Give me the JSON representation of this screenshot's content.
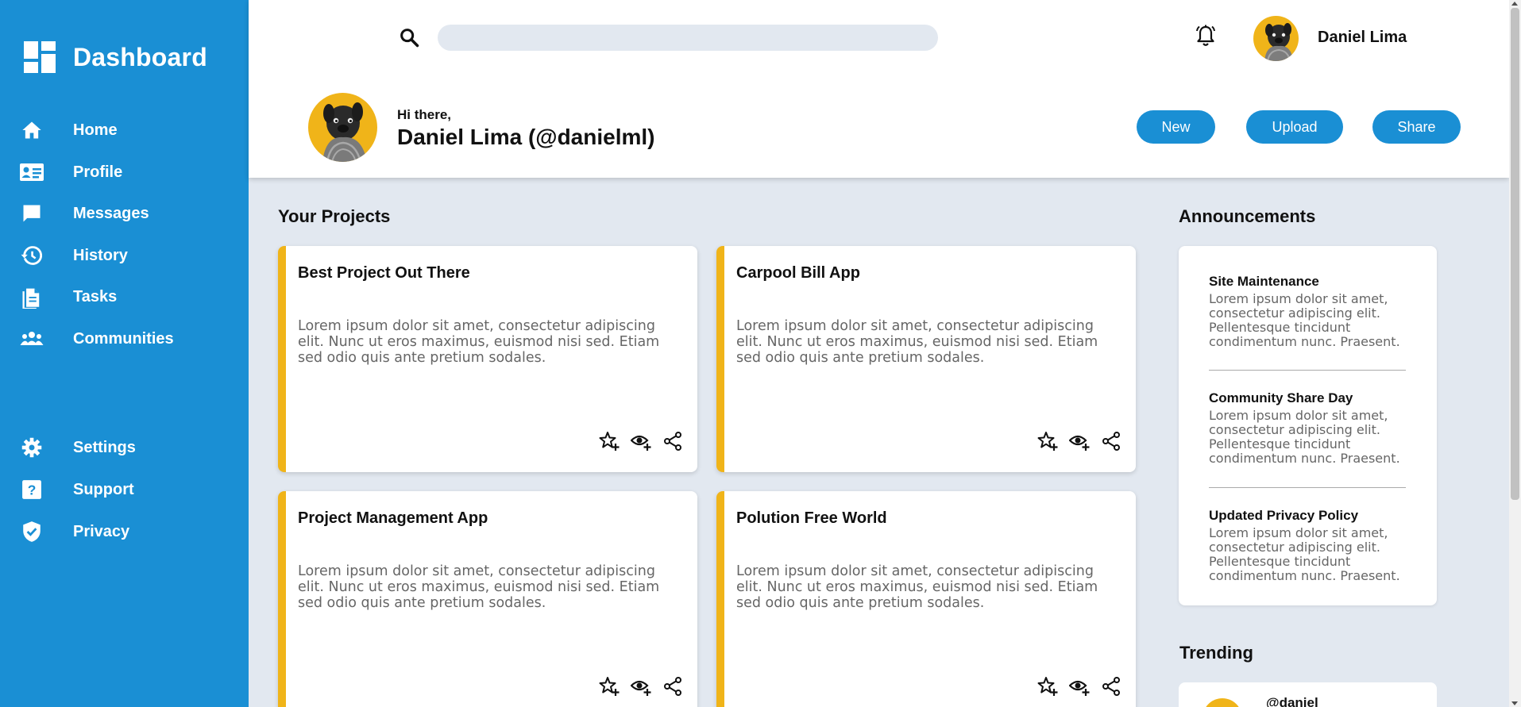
{
  "sidebar": {
    "title": "Dashboard",
    "items": [
      {
        "label": "Home",
        "icon": "home-icon"
      },
      {
        "label": "Profile",
        "icon": "id-card-icon"
      },
      {
        "label": "Messages",
        "icon": "chat-icon"
      },
      {
        "label": "History",
        "icon": "history-icon"
      },
      {
        "label": "Tasks",
        "icon": "document-icon"
      },
      {
        "label": "Communities",
        "icon": "people-icon"
      }
    ],
    "bottom_items": [
      {
        "label": "Settings",
        "icon": "gear-icon"
      },
      {
        "label": "Support",
        "icon": "help-icon"
      },
      {
        "label": "Privacy",
        "icon": "shield-icon"
      }
    ]
  },
  "header": {
    "search": {
      "placeholder": ""
    },
    "user_name": "Daniel Lima",
    "greeting": "Hi there,",
    "full_name": "Daniel Lima (@danielml)",
    "buttons": {
      "new": "New",
      "upload": "Upload",
      "share": "Share"
    }
  },
  "projects": {
    "title": "Your Projects",
    "cards": [
      {
        "title": "Best Project Out There",
        "description": "Lorem ipsum dolor sit amet, consectetur adipiscing elit. Nunc ut eros maximus, euismod nisi sed. Etiam sed odio quis ante pretium sodales."
      },
      {
        "title": "Carpool Bill App",
        "description": "Lorem ipsum dolor sit amet, consectetur adipiscing elit. Nunc ut eros maximus, euismod nisi sed. Etiam sed odio quis ante pretium sodales."
      },
      {
        "title": "Project Management App",
        "description": "Lorem ipsum dolor sit amet, consectetur adipiscing elit. Nunc ut eros maximus, euismod nisi sed. Etiam sed odio quis ante pretium sodales."
      },
      {
        "title": "Polution Free World",
        "description": "Lorem ipsum dolor sit amet, consectetur adipiscing elit. Nunc ut eros maximus, euismod nisi sed. Etiam sed odio quis ante pretium sodales."
      }
    ]
  },
  "announcements": {
    "title": "Announcements",
    "items": [
      {
        "title": "Site Maintenance",
        "body": "Lorem ipsum dolor sit amet, consectetur adipiscing elit. Pellentesque tincidunt condimentum nunc. Praesent."
      },
      {
        "title": "Community Share Day",
        "body": "Lorem ipsum dolor sit amet, consectetur adipiscing elit. Pellentesque tincidunt condimentum nunc. Praesent."
      },
      {
        "title": "Updated Privacy Policy",
        "body": "Lorem ipsum dolor sit amet, consectetur adipiscing elit. Pellentesque tincidunt condimentum nunc. Praesent."
      }
    ]
  },
  "trending": {
    "title": "Trending",
    "first_user": "@daniel"
  },
  "colors": {
    "sidebar": "#1a8fd4",
    "accent": "#f0b419",
    "background": "#e2e8f0"
  }
}
